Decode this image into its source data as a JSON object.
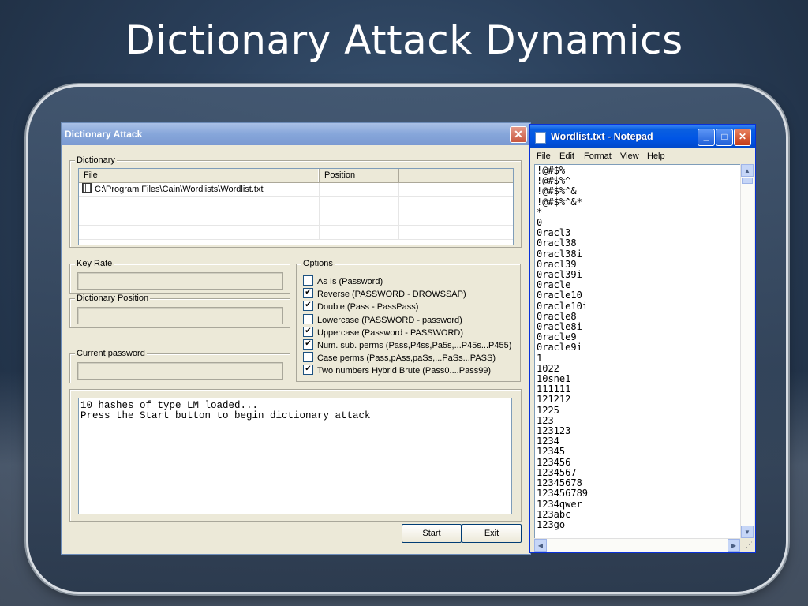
{
  "slide": {
    "title": "Dictionary Attack Dynamics"
  },
  "dialog": {
    "title": "Dictionary Attack",
    "close_glyph": "✕",
    "dictionary_group": "Dictionary",
    "columns": [
      "File",
      "Position"
    ],
    "rows": [
      {
        "file": "C:\\Program Files\\Cain\\Wordlists\\Wordlist.txt",
        "position": ""
      }
    ],
    "key_rate_label": "Key Rate",
    "dictionary_position_label": "Dictionary Position",
    "current_password_label": "Current password",
    "options_label": "Options",
    "options": [
      {
        "label": "As Is (Password)",
        "checked": false
      },
      {
        "label": "Reverse (PASSWORD - DROWSSAP)",
        "checked": true
      },
      {
        "label": "Double (Pass - PassPass)",
        "checked": true
      },
      {
        "label": "Lowercase (PASSWORD - password)",
        "checked": false
      },
      {
        "label": "Uppercase (Password - PASSWORD)",
        "checked": true
      },
      {
        "label": "Num. sub. perms (Pass,P4ss,Pa5s,...P45s...P455)",
        "checked": true
      },
      {
        "label": "Case perms (Pass,pAss,paSs,...PaSs...PASS)",
        "checked": false
      },
      {
        "label": "Two numbers Hybrid Brute (Pass0....Pass99)",
        "checked": true
      }
    ],
    "console_lines": [
      "10 hashes of type LM loaded...",
      "Press the Start button to begin dictionary attack"
    ],
    "start_button": "Start",
    "exit_button": "Exit"
  },
  "notepad": {
    "title": "Wordlist.txt - Notepad",
    "menu": [
      "File",
      "Edit",
      "Format",
      "View",
      "Help"
    ],
    "minimize_glyph": "_",
    "maximize_glyph": "□",
    "close_glyph": "✕",
    "lines": [
      "!@#$%",
      "!@#$%^",
      "!@#$%^&",
      "!@#$%^&*",
      "*",
      "0",
      "0racl3",
      "0racl38",
      "0racl38i",
      "0racl39",
      "0racl39i",
      "0racle",
      "0racle10",
      "0racle10i",
      "0racle8",
      "0racle8i",
      "0racle9",
      "0racle9i",
      "1",
      "1022",
      "10sne1",
      "111111",
      "121212",
      "1225",
      "123",
      "123123",
      "1234",
      "12345",
      "123456",
      "1234567",
      "12345678",
      "123456789",
      "1234qwer",
      "123abc",
      "123go"
    ]
  }
}
